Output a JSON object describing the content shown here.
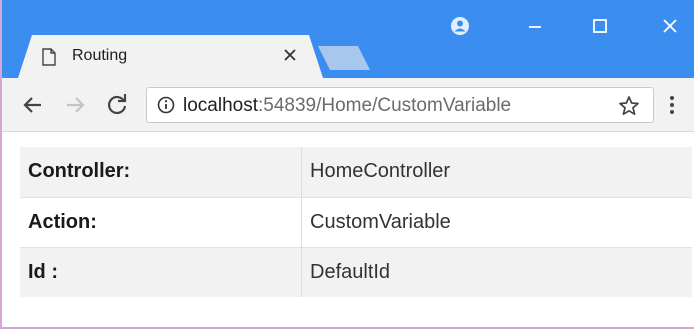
{
  "browser": {
    "tab": {
      "title": "Routing"
    },
    "address": {
      "host": "localhost",
      "rest": ":54839/Home/CustomVariable"
    }
  },
  "icons": {
    "profile": "profile-icon",
    "minimize": "minimize-icon",
    "maximize": "maximize-icon",
    "close": "close-icon",
    "back": "back-arrow-icon",
    "forward": "forward-arrow-icon",
    "reload": "reload-icon",
    "info": "info-icon",
    "star": "star-icon",
    "menu": "kebab-menu-icon",
    "page": "page-icon"
  },
  "colors": {
    "titlebar": "#3b8ef0",
    "toolbar": "#f2f2f2",
    "row_shade": "#f2f2f2"
  },
  "table": {
    "rows": [
      {
        "key": "Controller:",
        "value": "HomeController"
      },
      {
        "key": "Action:",
        "value": "CustomVariable"
      },
      {
        "key": "Id :",
        "value": "DefaultId"
      }
    ]
  }
}
